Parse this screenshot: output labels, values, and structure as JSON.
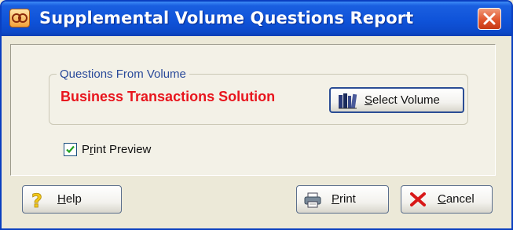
{
  "window": {
    "title": "Supplemental Volume Questions Report",
    "title_bar_color": "#0f53d9",
    "close_icon": "close-icon"
  },
  "group": {
    "legend": "Questions From Volume",
    "volume_name": "Business Transactions Solution",
    "volume_name_color": "#e8161e"
  },
  "select_volume": {
    "label_key": "S",
    "label_rest": "elect Volume",
    "icon": "books-icon"
  },
  "print_preview": {
    "label_pre": "P",
    "label_key": "r",
    "label_rest": "int Preview",
    "checked": true
  },
  "footer": {
    "help": {
      "label_key": "H",
      "label_rest": "elp",
      "icon": "question-mark-icon"
    },
    "print": {
      "label_key": "P",
      "label_rest": "rint",
      "icon": "printer-icon"
    },
    "cancel": {
      "label_key": "C",
      "label_rest": "ancel",
      "icon": "red-x-icon"
    }
  }
}
